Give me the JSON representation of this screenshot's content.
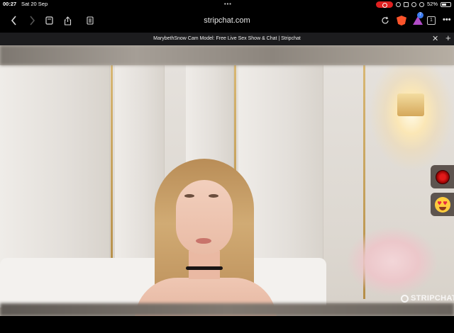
{
  "status_bar": {
    "time": "00:27",
    "date": "Sat 20 Sep",
    "battery": "52%"
  },
  "toolbar": {
    "url": "stripchat.com",
    "rewards_badge": "7",
    "tab_count": "1",
    "more": "•••"
  },
  "tab": {
    "title": "MarybethSnow Cam Model: Free Live Sex Show & Chat | Stripchat"
  },
  "video": {
    "watermark": "STRIPCHAT"
  },
  "icons": {
    "back": "chevron-left-icon",
    "forward": "chevron-right-icon",
    "bookmarks": "bookmark-icon",
    "share": "share-icon",
    "reader": "reader-icon",
    "reload": "reload-icon",
    "brave": "brave-shield-icon",
    "rewards": "brave-rewards-icon",
    "close_tab": "close-icon",
    "new_tab": "plus-icon"
  },
  "colors": {
    "record_pill": "#e02020",
    "brave": "#fb542b",
    "rewards": "#b14cc7",
    "tab_bar": "#1c1c1e"
  }
}
